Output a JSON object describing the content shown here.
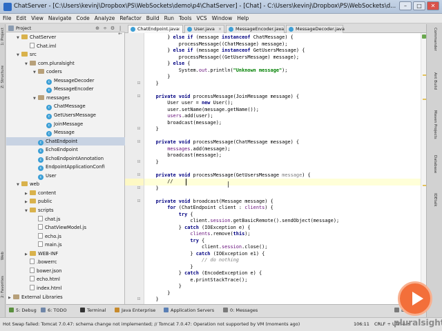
{
  "window": {
    "title": "ChatServer - [C:\\Users\\kevinj\\Dropbox\\PS\\WebSockets\\demo\\p4\\ChatServer] - [Chat] - C:\\Users\\kevinj\\Dropbox\\PS\\WebSockets\\d...",
    "minimize": "–",
    "maximize": "□",
    "close": "✕"
  },
  "menu": [
    "File",
    "Edit",
    "View",
    "Navigate",
    "Code",
    "Analyze",
    "Refactor",
    "Build",
    "Run",
    "Tools",
    "VCS",
    "Window",
    "Help"
  ],
  "left_strip": [
    "1: Project",
    "Z: Structure",
    "Web",
    "2: Favorites"
  ],
  "right_strip": [
    "Commander",
    "Ant Build",
    "Maven Projects",
    "Database",
    "IDEtalk"
  ],
  "project_panel": {
    "header": "Project",
    "tools": [
      "⊕",
      "÷",
      "⚙",
      "|←"
    ],
    "tree": [
      {
        "label": "ChatServer",
        "kind": "folder",
        "depth": 1,
        "arrow": "▼"
      },
      {
        "label": "Chat.iml",
        "kind": "file",
        "depth": 2,
        "arrow": ""
      },
      {
        "label": "src",
        "kind": "folder",
        "depth": 1,
        "arrow": "▼"
      },
      {
        "label": "com.pluralsight",
        "kind": "package",
        "depth": 2,
        "arrow": "▼"
      },
      {
        "label": "coders",
        "kind": "package",
        "depth": 3,
        "arrow": "▼"
      },
      {
        "label": "MessageDecoder",
        "kind": "class",
        "depth": 4,
        "arrow": ""
      },
      {
        "label": "MessageEncoder",
        "kind": "class",
        "depth": 4,
        "arrow": ""
      },
      {
        "label": "messages",
        "kind": "package",
        "depth": 3,
        "arrow": "▼"
      },
      {
        "label": "ChatMessage",
        "kind": "class",
        "depth": 4,
        "arrow": ""
      },
      {
        "label": "GetUsersMessage",
        "kind": "class",
        "depth": 4,
        "arrow": ""
      },
      {
        "label": "JoinMessage",
        "kind": "class",
        "depth": 4,
        "arrow": ""
      },
      {
        "label": "Message",
        "kind": "class",
        "depth": 4,
        "arrow": ""
      },
      {
        "label": "ChatEndpoint",
        "kind": "class",
        "depth": 3,
        "arrow": "",
        "selected": true
      },
      {
        "label": "EchoEndpoint",
        "kind": "class",
        "depth": 3,
        "arrow": ""
      },
      {
        "label": "EchoEndpointAnnotation",
        "kind": "class",
        "depth": 3,
        "arrow": ""
      },
      {
        "label": "EndpointApplicationConfi",
        "kind": "class",
        "depth": 3,
        "arrow": ""
      },
      {
        "label": "User",
        "kind": "class",
        "depth": 3,
        "arrow": ""
      },
      {
        "label": "web",
        "kind": "folder",
        "depth": 1,
        "arrow": "▼"
      },
      {
        "label": "content",
        "kind": "folder",
        "depth": 2,
        "arrow": "▶"
      },
      {
        "label": "public",
        "kind": "folder",
        "depth": 2,
        "arrow": "▶"
      },
      {
        "label": "scripts",
        "kind": "folder",
        "depth": 2,
        "arrow": "▼"
      },
      {
        "label": "chat.js",
        "kind": "file",
        "depth": 3,
        "arrow": ""
      },
      {
        "label": "ChatViewModel.js",
        "kind": "file",
        "depth": 3,
        "arrow": ""
      },
      {
        "label": "echo.js",
        "kind": "file",
        "depth": 3,
        "arrow": ""
      },
      {
        "label": "main.js",
        "kind": "file",
        "depth": 3,
        "arrow": ""
      },
      {
        "label": "WEB-INF",
        "kind": "folder",
        "depth": 2,
        "arrow": "▶"
      },
      {
        "label": ".bowerrc",
        "kind": "file",
        "depth": 2,
        "arrow": ""
      },
      {
        "label": "bower.json",
        "kind": "file",
        "depth": 2,
        "arrow": ""
      },
      {
        "label": "echo.html",
        "kind": "file",
        "depth": 2,
        "arrow": ""
      },
      {
        "label": "index.html",
        "kind": "file",
        "depth": 2,
        "arrow": ""
      },
      {
        "label": "External Libraries",
        "kind": "library",
        "depth": 0,
        "arrow": "▶"
      }
    ]
  },
  "tabs": [
    {
      "label": "ChatEndpoint.java",
      "active": true
    },
    {
      "label": "User.java",
      "active": false
    },
    {
      "label": "MessageEncoder.java",
      "active": false
    },
    {
      "label": "MessageDecoder.java",
      "active": false
    }
  ],
  "code": [
    [
      {
        "t": "        } "
      },
      {
        "t": "else if",
        "c": "kw"
      },
      {
        "t": " (message "
      },
      {
        "t": "instanceof",
        "c": "kw"
      },
      {
        "t": " ChatMessage) {"
      }
    ],
    [
      {
        "t": "            processMessage((ChatMessage) message);"
      }
    ],
    [
      {
        "t": "        } "
      },
      {
        "t": "else if",
        "c": "kw"
      },
      {
        "t": " (message "
      },
      {
        "t": "instanceof",
        "c": "kw"
      },
      {
        "t": " GetUsersMessage) {"
      }
    ],
    [
      {
        "t": "            processMessage((GetUsersMessage) message);"
      }
    ],
    [
      {
        "t": "        } "
      },
      {
        "t": "else",
        "c": "kw"
      },
      {
        "t": " {"
      }
    ],
    [
      {
        "t": "            System."
      },
      {
        "t": "out",
        "c": "fld2"
      },
      {
        "t": ".println("
      },
      {
        "t": "\"Unknown message\"",
        "c": "str"
      },
      {
        "t": ");"
      }
    ],
    [
      {
        "t": "        }"
      }
    ],
    [
      {
        "t": "    }"
      }
    ],
    [
      {
        "t": ""
      }
    ],
    [
      {
        "t": "    "
      },
      {
        "t": "private void",
        "c": "kw"
      },
      {
        "t": " processMessage(JoinMessage message) {"
      }
    ],
    [
      {
        "t": "        User user = "
      },
      {
        "t": "new",
        "c": "kw"
      },
      {
        "t": " User();"
      }
    ],
    [
      {
        "t": "        user.setName(message.getName());"
      }
    ],
    [
      {
        "t": "        "
      },
      {
        "t": "users",
        "c": "fld2"
      },
      {
        "t": ".add(user);"
      }
    ],
    [
      {
        "t": "        broadcast(message);"
      }
    ],
    [
      {
        "t": "    }"
      }
    ],
    [
      {
        "t": ""
      }
    ],
    [
      {
        "t": "    "
      },
      {
        "t": "private void",
        "c": "kw"
      },
      {
        "t": " processMessage(ChatMessage message) {"
      }
    ],
    [
      {
        "t": "        "
      },
      {
        "t": "messages",
        "c": "fld2"
      },
      {
        "t": ".add(message);"
      }
    ],
    [
      {
        "t": "        broadcast(message);"
      }
    ],
    [
      {
        "t": "    }"
      }
    ],
    [
      {
        "t": ""
      }
    ],
    [
      {
        "t": "    "
      },
      {
        "t": "private void",
        "c": "kw"
      },
      {
        "t": " processMessage(GetUsersMessage "
      },
      {
        "t": "message",
        "c": "param"
      },
      {
        "t": ") {"
      }
    ],
    [
      {
        "t": "        //"
      }
    ],
    [
      {
        "t": "    }"
      }
    ],
    [
      {
        "t": ""
      }
    ],
    [
      {
        "t": "    "
      },
      {
        "t": "private void",
        "c": "kw"
      },
      {
        "t": " broadcast(Message message) {"
      }
    ],
    [
      {
        "t": "        "
      },
      {
        "t": "for",
        "c": "kw"
      },
      {
        "t": " (ChatEndpoint client : "
      },
      {
        "t": "clients",
        "c": "fld2"
      },
      {
        "t": ") {"
      }
    ],
    [
      {
        "t": "            "
      },
      {
        "t": "try",
        "c": "kw"
      },
      {
        "t": " {"
      }
    ],
    [
      {
        "t": "                client."
      },
      {
        "t": "session",
        "c": "fld2"
      },
      {
        "t": ".getBasicRemote().sendObject(message);"
      }
    ],
    [
      {
        "t": "            } "
      },
      {
        "t": "catch",
        "c": "kw"
      },
      {
        "t": " (IOException e) {"
      }
    ],
    [
      {
        "t": "                "
      },
      {
        "t": "clients",
        "c": "fld2"
      },
      {
        "t": ".remove("
      },
      {
        "t": "this",
        "c": "kw"
      },
      {
        "t": ");"
      }
    ],
    [
      {
        "t": "                "
      },
      {
        "t": "try",
        "c": "kw"
      },
      {
        "t": " {"
      }
    ],
    [
      {
        "t": "                    client."
      },
      {
        "t": "session",
        "c": "fld2"
      },
      {
        "t": ".close();"
      }
    ],
    [
      {
        "t": "                } "
      },
      {
        "t": "catch",
        "c": "kw"
      },
      {
        "t": " (IOException e1) {"
      }
    ],
    [
      {
        "t": "                    "
      },
      {
        "t": "// do nothing",
        "c": "cmt"
      }
    ],
    [
      {
        "t": "                }"
      }
    ],
    [
      {
        "t": "            } "
      },
      {
        "t": "catch",
        "c": "kw"
      },
      {
        "t": " (EncodeException e) {"
      }
    ],
    [
      {
        "t": "                e.printStackTrace();"
      }
    ],
    [
      {
        "t": "            }"
      }
    ],
    [
      {
        "t": "        }"
      }
    ],
    [
      {
        "t": "    }"
      }
    ]
  ],
  "current_line": 22,
  "bottom_tools": [
    {
      "label": "5: Debug",
      "color": "#5a8f3e"
    },
    {
      "label": "6: TODO",
      "color": "#6f86a8"
    },
    {
      "label": "Terminal",
      "color": "#333333"
    },
    {
      "label": "Java Enterprise",
      "color": "#c78a2c"
    },
    {
      "label": "Application Servers",
      "color": "#5a7fb5"
    },
    {
      "label": "0: Messages",
      "color": "#7a7a7a"
    },
    {
      "label": "Event Log",
      "color": "#7a7a7a"
    }
  ],
  "status": {
    "message": "Hot Swap failed: Tomcat 7.0.47: schema change not implemented; // Tomcat 7.0.47: Operation not supported by VM (moments ago)",
    "position": "106:11",
    "encoding": "CRLF ÷  UTF-8 ÷"
  },
  "brand": "pluralsight",
  "colors": {
    "keyword": "#000080",
    "field": "#660e7a",
    "string": "#008000",
    "comment": "#808080",
    "play_button": "#f36f3a"
  }
}
